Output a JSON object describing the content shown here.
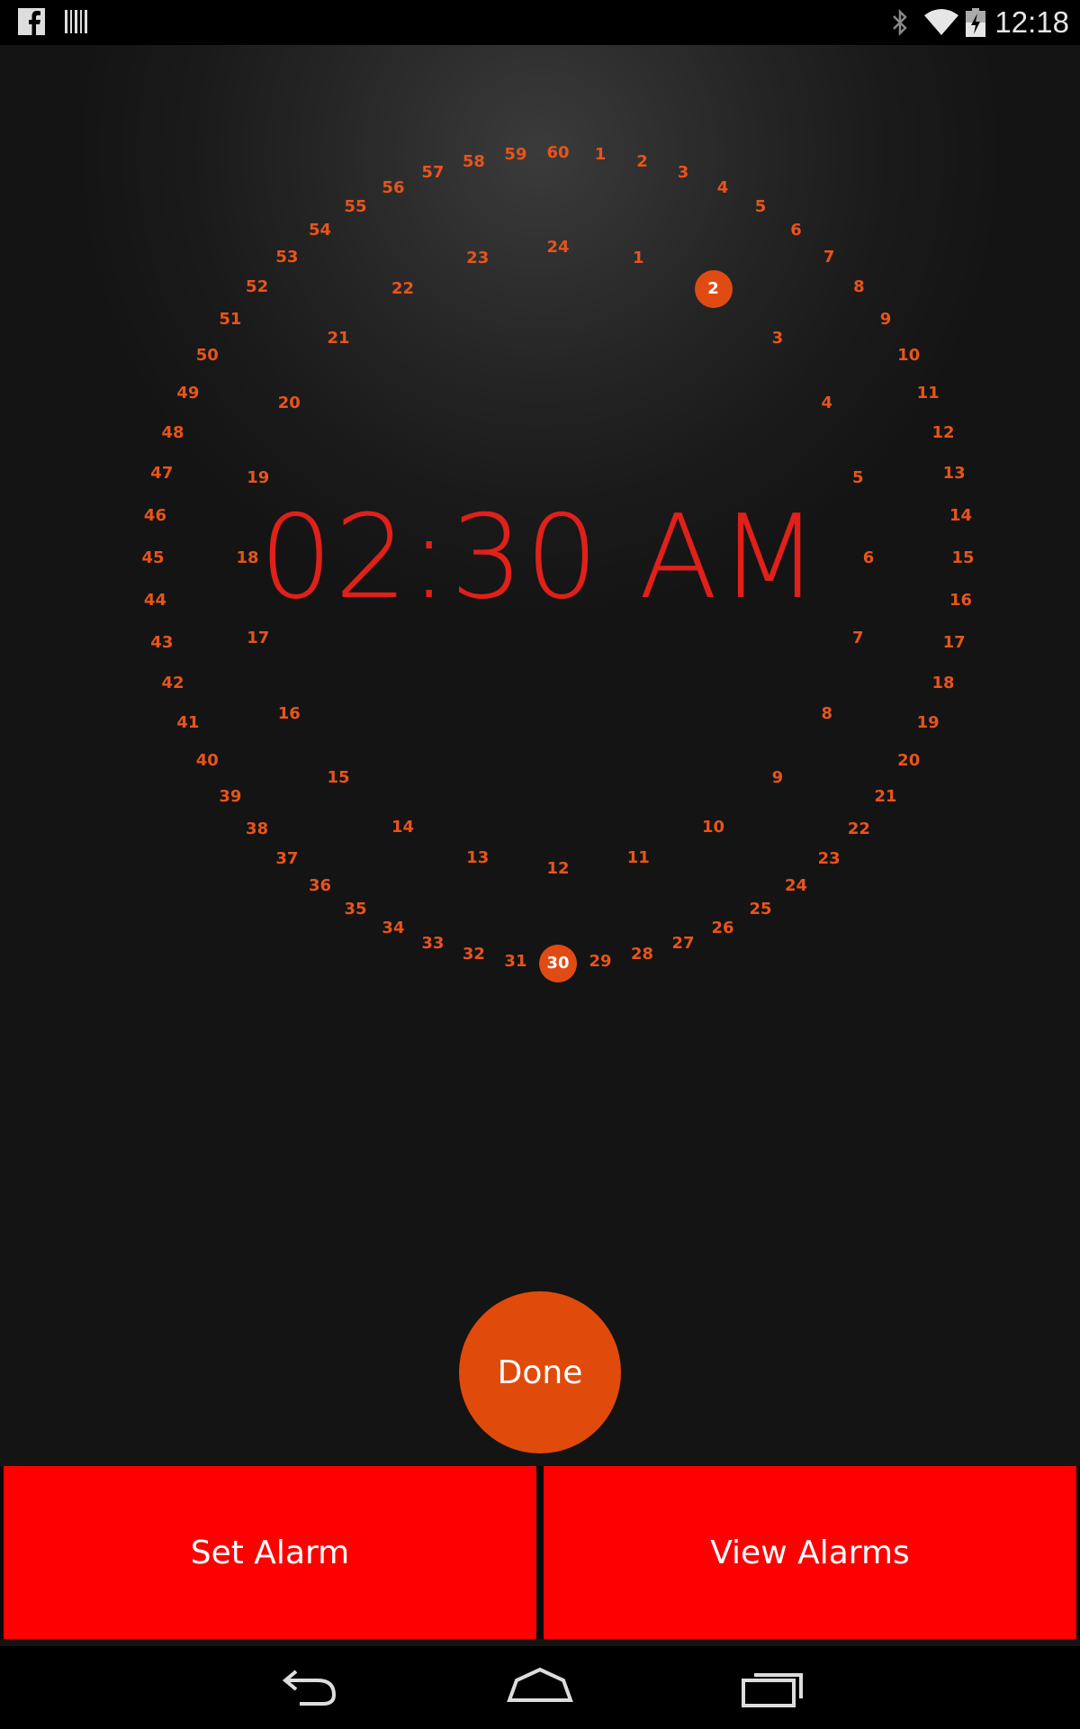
{
  "status_bar": {
    "time": "12:18",
    "icons": [
      "facebook-icon",
      "barcode-icon",
      "bluetooth-icon",
      "wifi-icon",
      "battery-charging-icon"
    ]
  },
  "clock": {
    "time_text": "02:30 AM",
    "selected_hour": 2,
    "selected_minute": 30,
    "hour_ring": [
      "24",
      "1",
      "2",
      "3",
      "4",
      "5",
      "6",
      "7",
      "8",
      "9",
      "10",
      "11",
      "12",
      "13",
      "14",
      "15",
      "16",
      "17",
      "18",
      "19",
      "20",
      "21",
      "22",
      "23"
    ],
    "minute_ring": [
      "60",
      "1",
      "2",
      "3",
      "4",
      "5",
      "6",
      "7",
      "8",
      "9",
      "10",
      "11",
      "12",
      "13",
      "14",
      "15",
      "16",
      "17",
      "18",
      "19",
      "20",
      "21",
      "22",
      "23",
      "24",
      "25",
      "26",
      "27",
      "28",
      "29",
      "30",
      "31",
      "32",
      "33",
      "34",
      "35",
      "36",
      "37",
      "38",
      "39",
      "40",
      "41",
      "42",
      "43",
      "44",
      "45",
      "46",
      "47",
      "48",
      "49",
      "50",
      "51",
      "52",
      "53",
      "54",
      "55",
      "56",
      "57",
      "58",
      "59"
    ],
    "accent_color": "#e8541b"
  },
  "buttons": {
    "done": "Done",
    "set_alarm": "Set Alarm",
    "view_alarms": "View Alarms"
  },
  "colors": {
    "action_red": "#fe0000",
    "done_orange": "#e04b0b",
    "time_red": "#e0201a"
  },
  "nav": [
    "back-icon",
    "home-icon",
    "recents-icon"
  ]
}
